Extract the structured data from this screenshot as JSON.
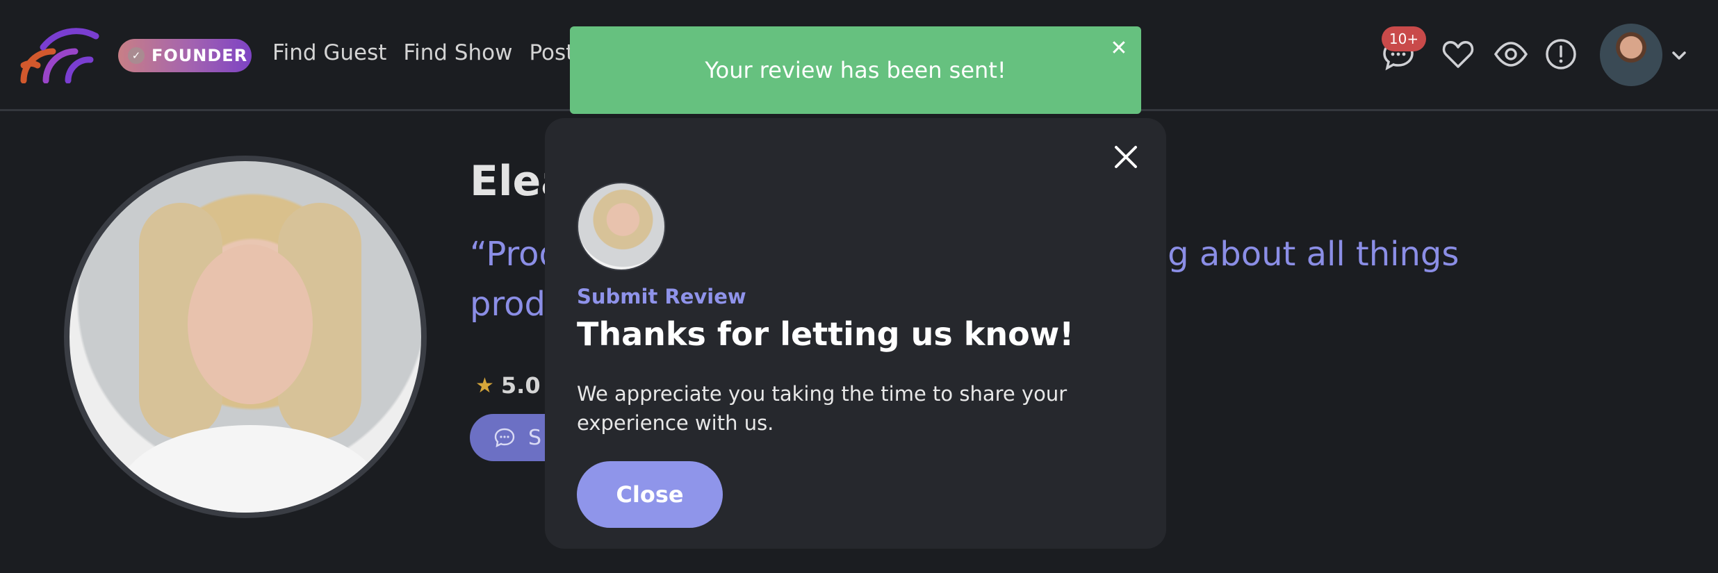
{
  "header": {
    "founder_badge": "FOUNDER",
    "nav": [
      {
        "label": "Find Guest"
      },
      {
        "label": "Find Show"
      },
      {
        "label": "Posts"
      }
    ],
    "messages_badge": "10+",
    "icons": [
      "logo-icon",
      "messages-icon",
      "heart-icon",
      "eye-icon",
      "alert-icon",
      "avatar",
      "chevron-down-icon"
    ]
  },
  "profile": {
    "name_visible": "Elea",
    "tagline_part1": "“Prod",
    "tagline_part2": "king about all things",
    "tagline_line2": "prod",
    "rating": "5.0",
    "rating_suffix": "/",
    "send_button_label": "S"
  },
  "toast": {
    "message": "Your review has been sent!",
    "color": "#66c17f"
  },
  "modal": {
    "kicker": "Submit Review",
    "title": "Thanks for letting us know!",
    "body": "We appreciate you taking the time to share your experience with us.",
    "close_button": "Close",
    "accent": "#8f95ea"
  }
}
